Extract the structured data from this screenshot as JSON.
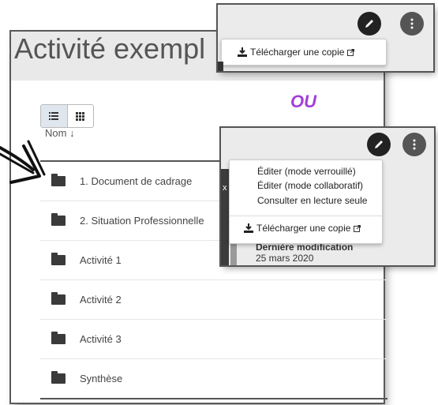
{
  "main": {
    "title": "Activité exempl",
    "sort_label": "Nom",
    "sort_arrow": "↓",
    "rows": [
      {
        "label": "1. Document de cadrage"
      },
      {
        "label": "2. Situation Professionnelle"
      },
      {
        "label": "Activité 1"
      },
      {
        "label": "Activité 2"
      },
      {
        "label": "Activité 3"
      },
      {
        "label": "Synthèse"
      }
    ]
  },
  "ou_label": "OU",
  "popup1": {
    "download_label": "Télécharger une copie"
  },
  "popup2": {
    "items": {
      "edit_locked": "Éditer (mode verrouillé)",
      "edit_collab": "Éditer (mode collaboratif)",
      "read_only": "Consulter en lecture seule",
      "download": "Télécharger une copie"
    },
    "modified_title": "Dernière modification",
    "modified_date": "25 mars 2020",
    "side_glyph": "x"
  },
  "icons": {
    "list_view": "list-icon",
    "grid_view": "grid-icon",
    "folder": "folder-icon",
    "pencil": "pencil-icon",
    "more": "vertical-dots-icon",
    "download": "download-icon",
    "external": "external-link-icon"
  }
}
